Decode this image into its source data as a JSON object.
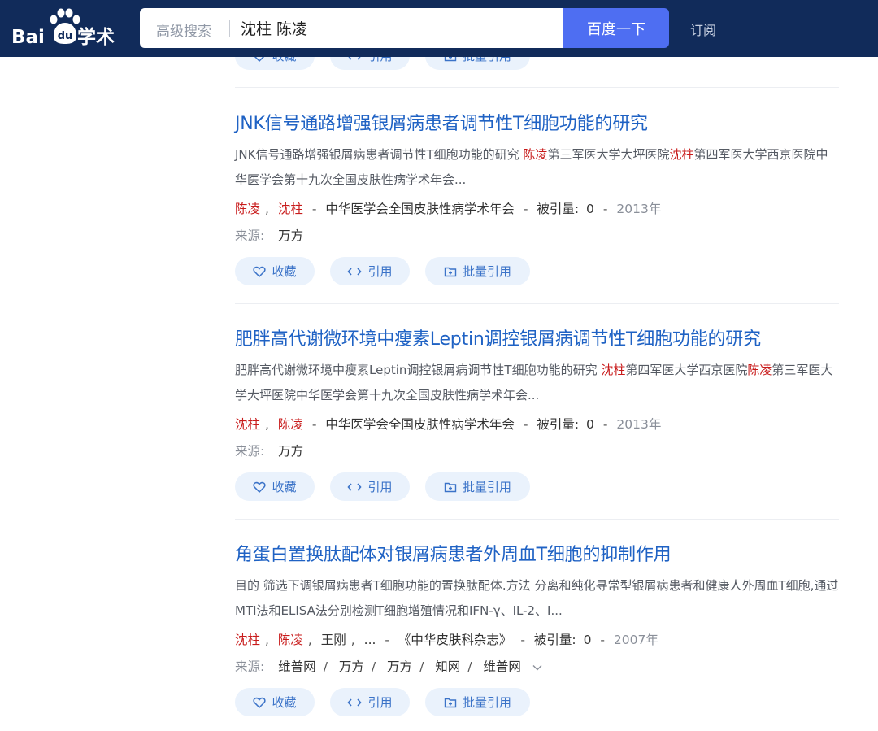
{
  "header": {
    "logo_text": "Bai",
    "logo_suffix": "学术",
    "logo_paw_text": "du",
    "advanced_search": "高级搜索",
    "query": "沈柱 陈凌",
    "search_button": "百度一下",
    "subscribe": "订阅"
  },
  "actions": {
    "favorite": "收藏",
    "cite": "引用",
    "batch_cite": "批量引用"
  },
  "results": [
    {
      "title": "JNK信号通路增强银屑病患者调节性T细胞功能的研究",
      "abstract_parts": [
        {
          "text": "JNK信号通路增强银屑病患者调节性T细胞功能的研究 ",
          "hl": false
        },
        {
          "text": "陈凌",
          "hl": true
        },
        {
          "text": "第三军医大学大坪医院",
          "hl": false
        },
        {
          "text": "沈柱",
          "hl": true
        },
        {
          "text": "第四军医大学西京医院中华医学会第十九次全国皮肤性病学术年会...",
          "hl": false
        }
      ],
      "authors": [
        {
          "name": "陈凌",
          "hl": true
        },
        {
          "name": "沈柱",
          "hl": true
        }
      ],
      "venue": "中华医学会全国皮肤性病学术年会",
      "cited_label": "被引量:",
      "cited": "0",
      "year": "2013年",
      "source_label": "来源:",
      "sources": [
        "万方"
      ]
    },
    {
      "title": "肥胖高代谢微环境中瘦素Leptin调控银屑病调节性T细胞功能的研究",
      "abstract_parts": [
        {
          "text": "肥胖高代谢微环境中瘦素Leptin调控银屑病调节性T细胞功能的研究 ",
          "hl": false
        },
        {
          "text": "沈柱",
          "hl": true
        },
        {
          "text": "第四军医大学西京医院",
          "hl": false
        },
        {
          "text": "陈凌",
          "hl": true
        },
        {
          "text": "第三军医大学大坪医院中华医学会第十九次全国皮肤性病学术年会...",
          "hl": false
        }
      ],
      "authors": [
        {
          "name": "沈柱",
          "hl": true
        },
        {
          "name": "陈凌",
          "hl": true
        }
      ],
      "venue": "中华医学会全国皮肤性病学术年会",
      "cited_label": "被引量:",
      "cited": "0",
      "year": "2013年",
      "source_label": "来源:",
      "sources": [
        "万方"
      ]
    },
    {
      "title": "角蛋白置换肽配体对银屑病患者外周血T细胞的抑制作用",
      "abstract_parts": [
        {
          "text": "目的 筛选下调银屑病患者T细胞功能的置换肽配体.方法 分离和纯化寻常型银屑病患者和健康人外周血T细胞,通过MTI法和ELISA法分别检测T细胞增殖情况和IFN-γ、IL-2、I...",
          "hl": false
        }
      ],
      "authors": [
        {
          "name": "沈柱",
          "hl": true
        },
        {
          "name": "陈凌",
          "hl": true
        },
        {
          "name": "王刚",
          "hl": false
        },
        {
          "name": "...",
          "hl": false
        }
      ],
      "venue": "《中华皮肤科杂志》",
      "cited_label": "被引量:",
      "cited": "0",
      "year": "2007年",
      "source_label": "来源:",
      "sources": [
        "维普网",
        "万方",
        "万方",
        "知网",
        "维普网"
      ]
    }
  ],
  "colors": {
    "header_bg": "#112b5a",
    "search_button_bg": "#4e6ef2",
    "title_link": "#1f62c4",
    "highlight": "#c81b1b",
    "pill_bg": "#eaf2fc",
    "pill_text": "#3b73c8"
  },
  "icons": {
    "favorite": "heart-icon",
    "cite": "code-brackets-icon",
    "batch_cite": "batch-cite-icon",
    "expand": "chevron-down-icon",
    "logo": "baidu-paw-icon"
  }
}
